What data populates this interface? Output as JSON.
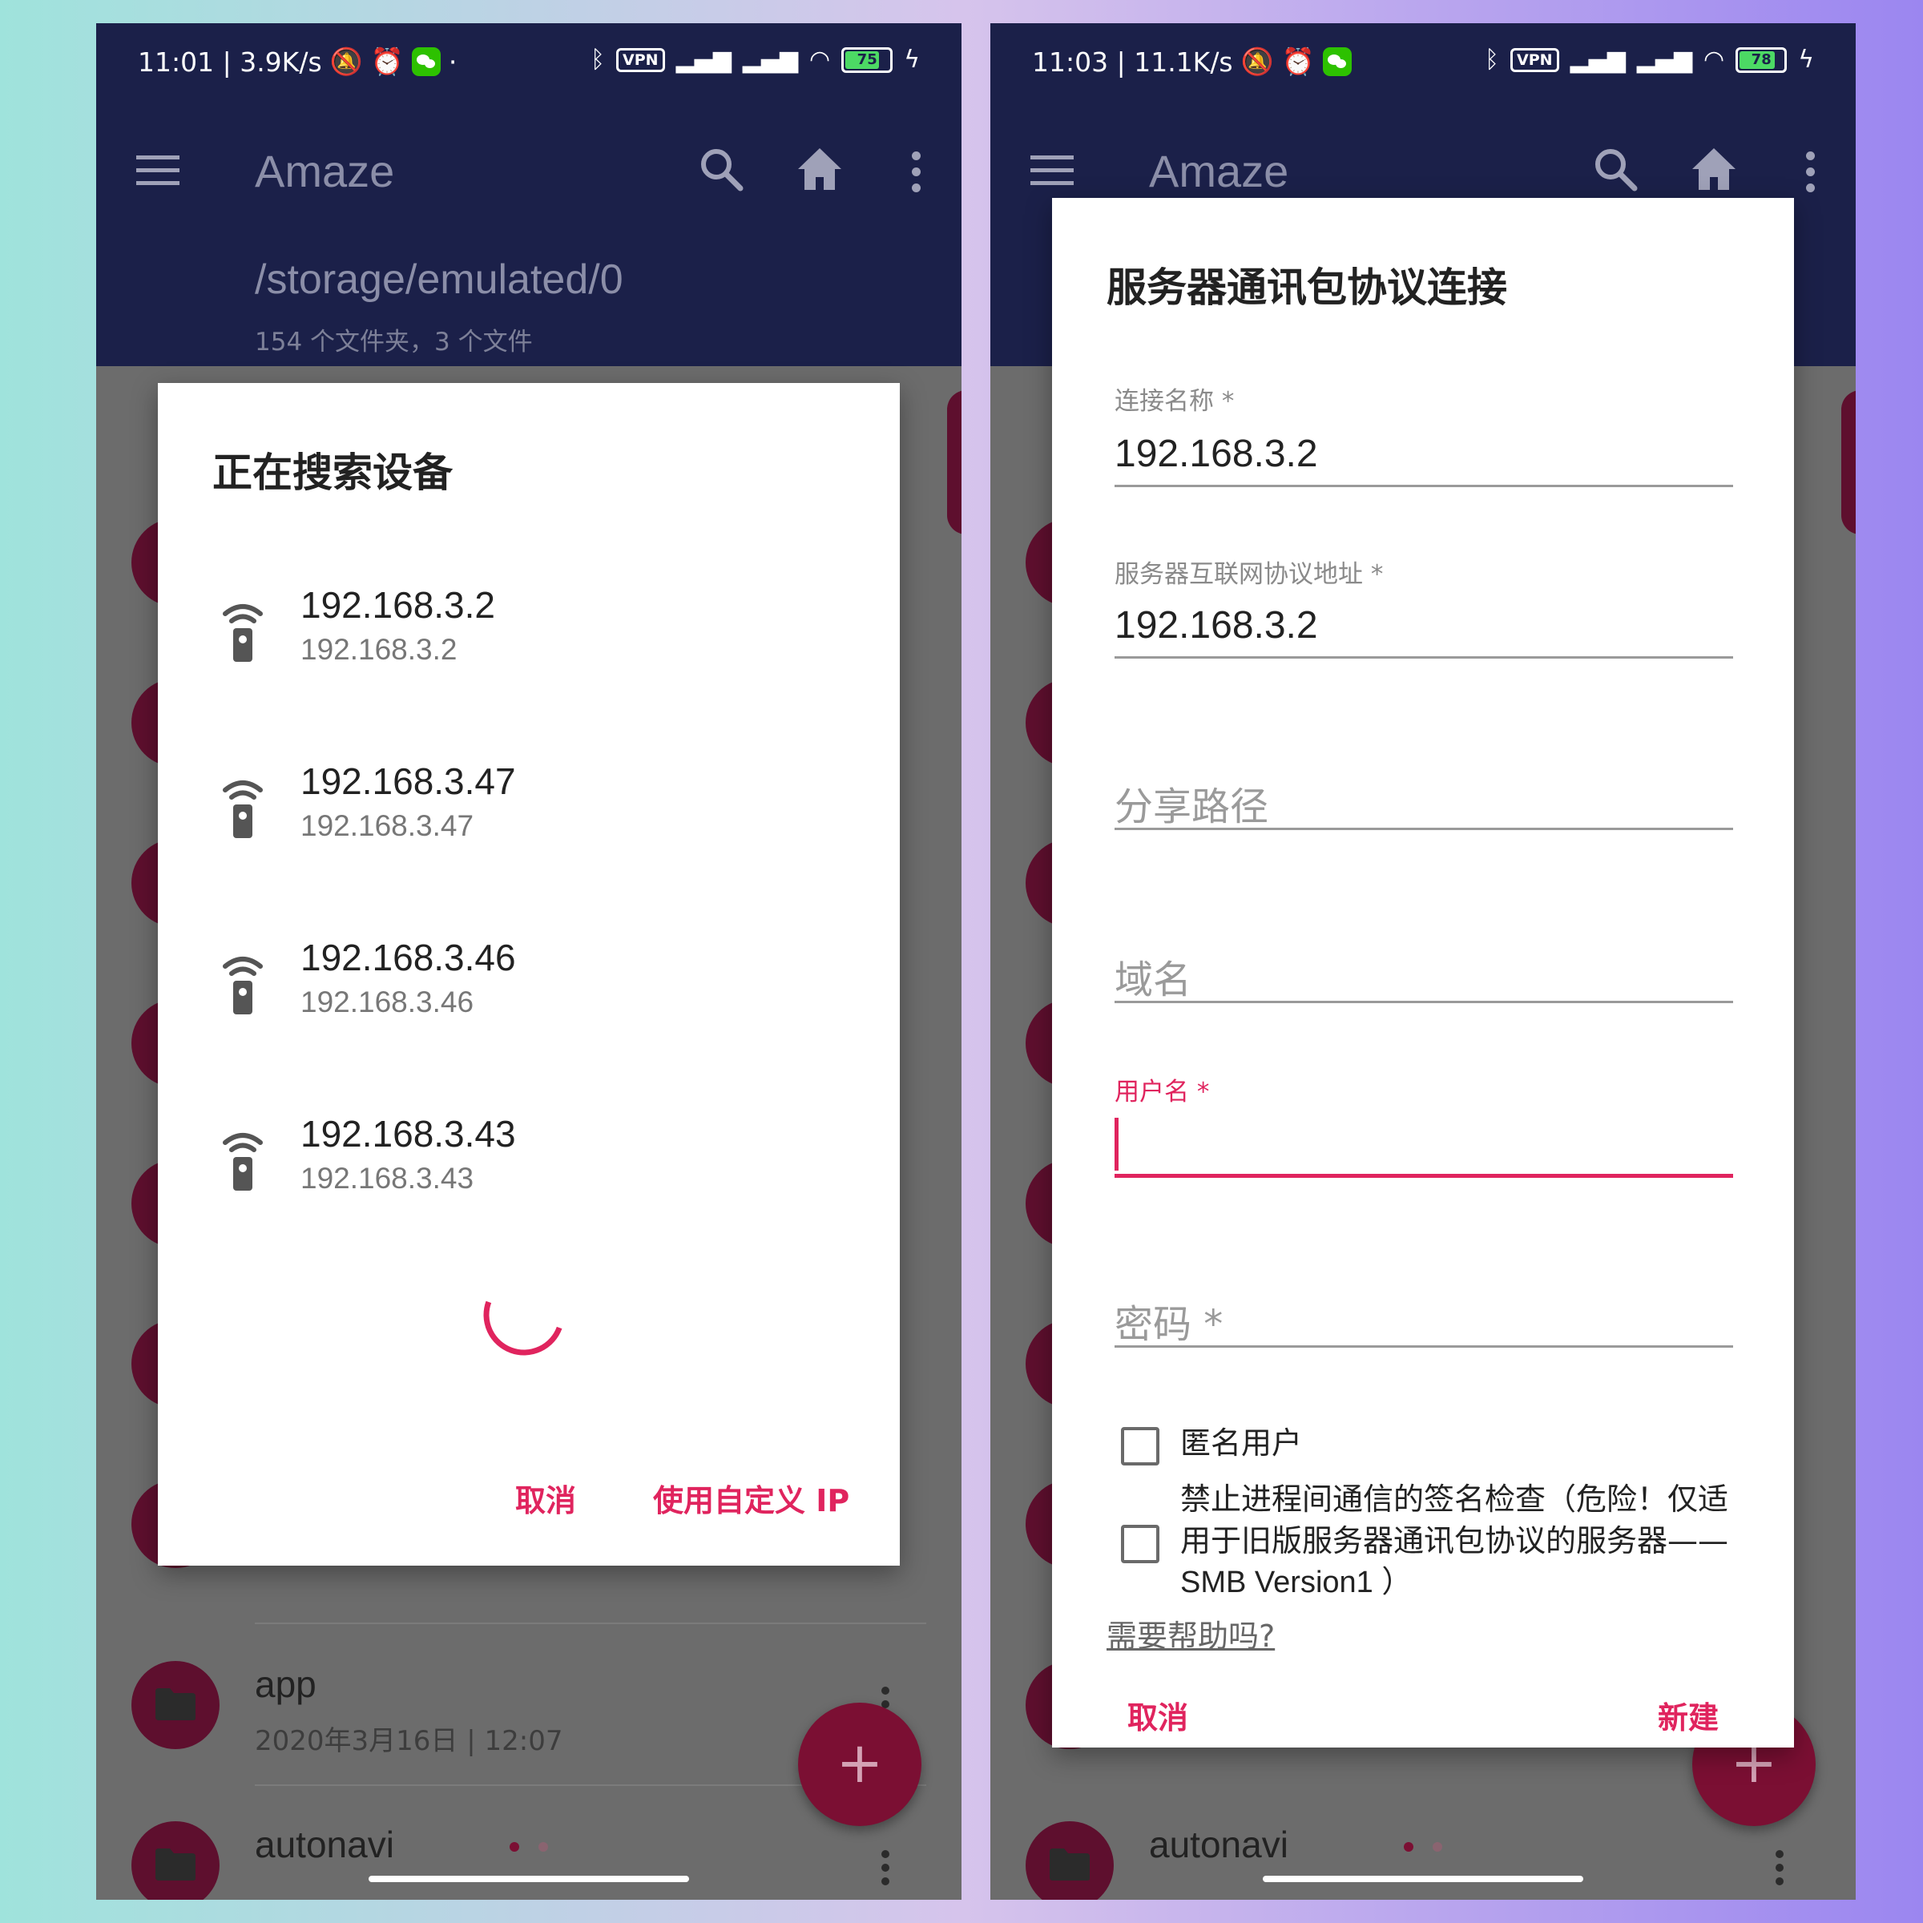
{
  "left_screen": {
    "status": {
      "time_speed": "11:01 | 3.9K/s",
      "extra": "·",
      "vpn": "VPN",
      "battery": "75"
    },
    "toolbar": {
      "title": "Amaze"
    },
    "path": {
      "current": "/storage/emulated/0",
      "summary": "154 个文件夹，3 个文件"
    },
    "list": [
      {
        "name": "app",
        "meta": "2020年3月16日 | 12:07"
      },
      {
        "name": "autonavi"
      }
    ],
    "fab": "+",
    "dialog": {
      "title": "正在搜索设备",
      "devices": [
        {
          "name": "192.168.3.2",
          "ip": "192.168.3.2"
        },
        {
          "name": "192.168.3.47",
          "ip": "192.168.3.47"
        },
        {
          "name": "192.168.3.46",
          "ip": "192.168.3.46"
        },
        {
          "name": "192.168.3.43",
          "ip": "192.168.3.43"
        }
      ],
      "cancel": "取消",
      "custom_ip": "使用自定义 IP"
    }
  },
  "right_screen": {
    "status": {
      "time_speed": "11:03 | 11.1K/s",
      "vpn": "VPN",
      "battery": "78"
    },
    "toolbar": {
      "title": "Amaze"
    },
    "list": [
      {
        "name": "autonavi"
      }
    ],
    "fab": "+",
    "dialog": {
      "title": "服务器通讯包协议连接",
      "fields": {
        "connection_name": {
          "label": "连接名称 *",
          "value": "192.168.3.2"
        },
        "server_ip": {
          "label": "服务器互联网协议地址 *",
          "value": "192.168.3.2"
        },
        "share_path": {
          "placeholder": "分享路径"
        },
        "domain": {
          "placeholder": "域名"
        },
        "username": {
          "label": "用户名 *",
          "value": ""
        },
        "password": {
          "placeholder": "密码 *"
        }
      },
      "anonymous": "匿名用户",
      "disable_signing": [
        "禁止进程间通信的签名检查（危险！仅适",
        "用于旧版服务器通讯包协议的服务器——",
        "SMB Version1 ）"
      ],
      "help": "需要帮助吗?",
      "cancel": "取消",
      "create": "新建"
    }
  },
  "colors": {
    "appbar": "#1b2049",
    "accent": "#e0245e",
    "folder": "#7b0f33"
  }
}
